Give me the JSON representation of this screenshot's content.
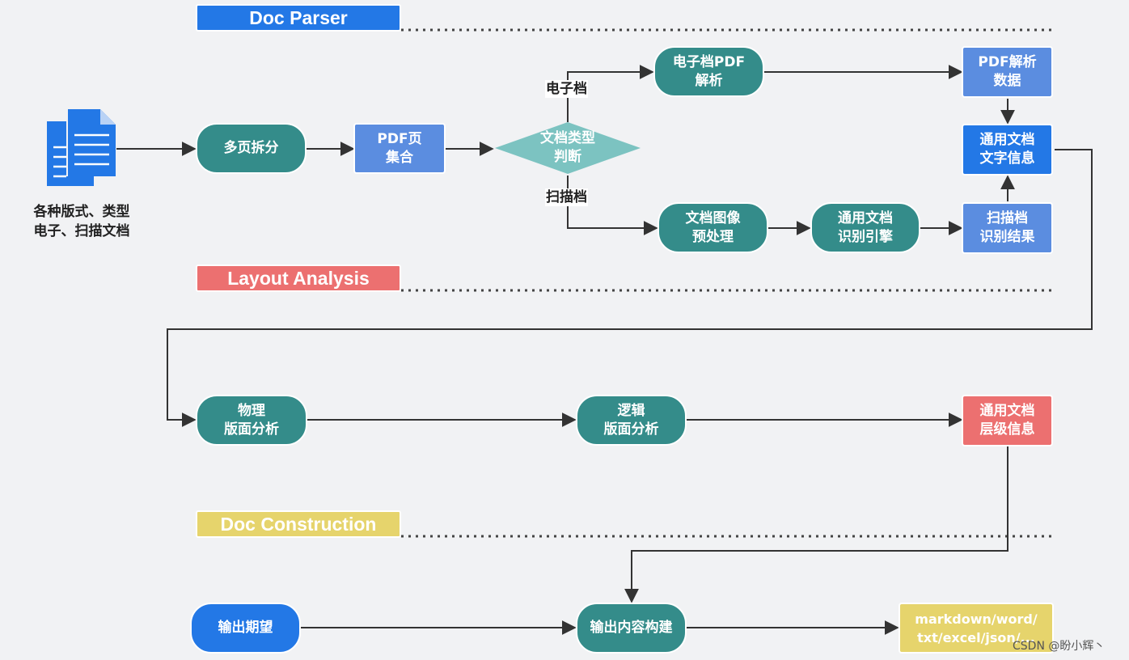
{
  "sections": {
    "doc_parser": {
      "label": "Doc Parser",
      "color": "#2378e6"
    },
    "layout_analysis": {
      "label": "Layout Analysis",
      "color": "#ec7070"
    },
    "doc_construction": {
      "label": "Doc Construction",
      "color": "#e6d46c"
    }
  },
  "input": {
    "icon": "document-stack-icon",
    "caption": "各种版式、类型\n电子、扫描文档"
  },
  "nodes": {
    "multi_page_split": "多页拆分",
    "pdf_page_set": "PDF页\n集合",
    "doc_type_decision": "文档类型\n判断",
    "electronic_pdf_parse": "电子档PDF\n解析",
    "pdf_parse_data": "PDF解析\n数据",
    "general_text_info": "通用文档\n文字信息",
    "image_preprocess": "文档图像\n预处理",
    "recognition_engine": "通用文档\n识别引擎",
    "scan_result": "扫描档\n识别结果",
    "physical_layout": "物理\n版面分析",
    "logical_layout": "逻辑\n版面分析",
    "hierarchy_info": "通用文档\n层级信息",
    "output_expectation": "输出期望",
    "output_build": "输出内容构建",
    "output_formats": "markdown/word/\ntxt/excel/json/..."
  },
  "branch_labels": {
    "electronic": "电子档",
    "scanned": "扫描档"
  },
  "colors": {
    "process": "#348c8a",
    "data_light": "#5b8de0",
    "data": "#2378e6",
    "decision": "#7cc3c1",
    "hierarchy": "#ec7070",
    "output": "#e6d46c",
    "connector": "#333333",
    "background": "#f1f2f4"
  },
  "watermark": "CSDN @盼小辉丶"
}
